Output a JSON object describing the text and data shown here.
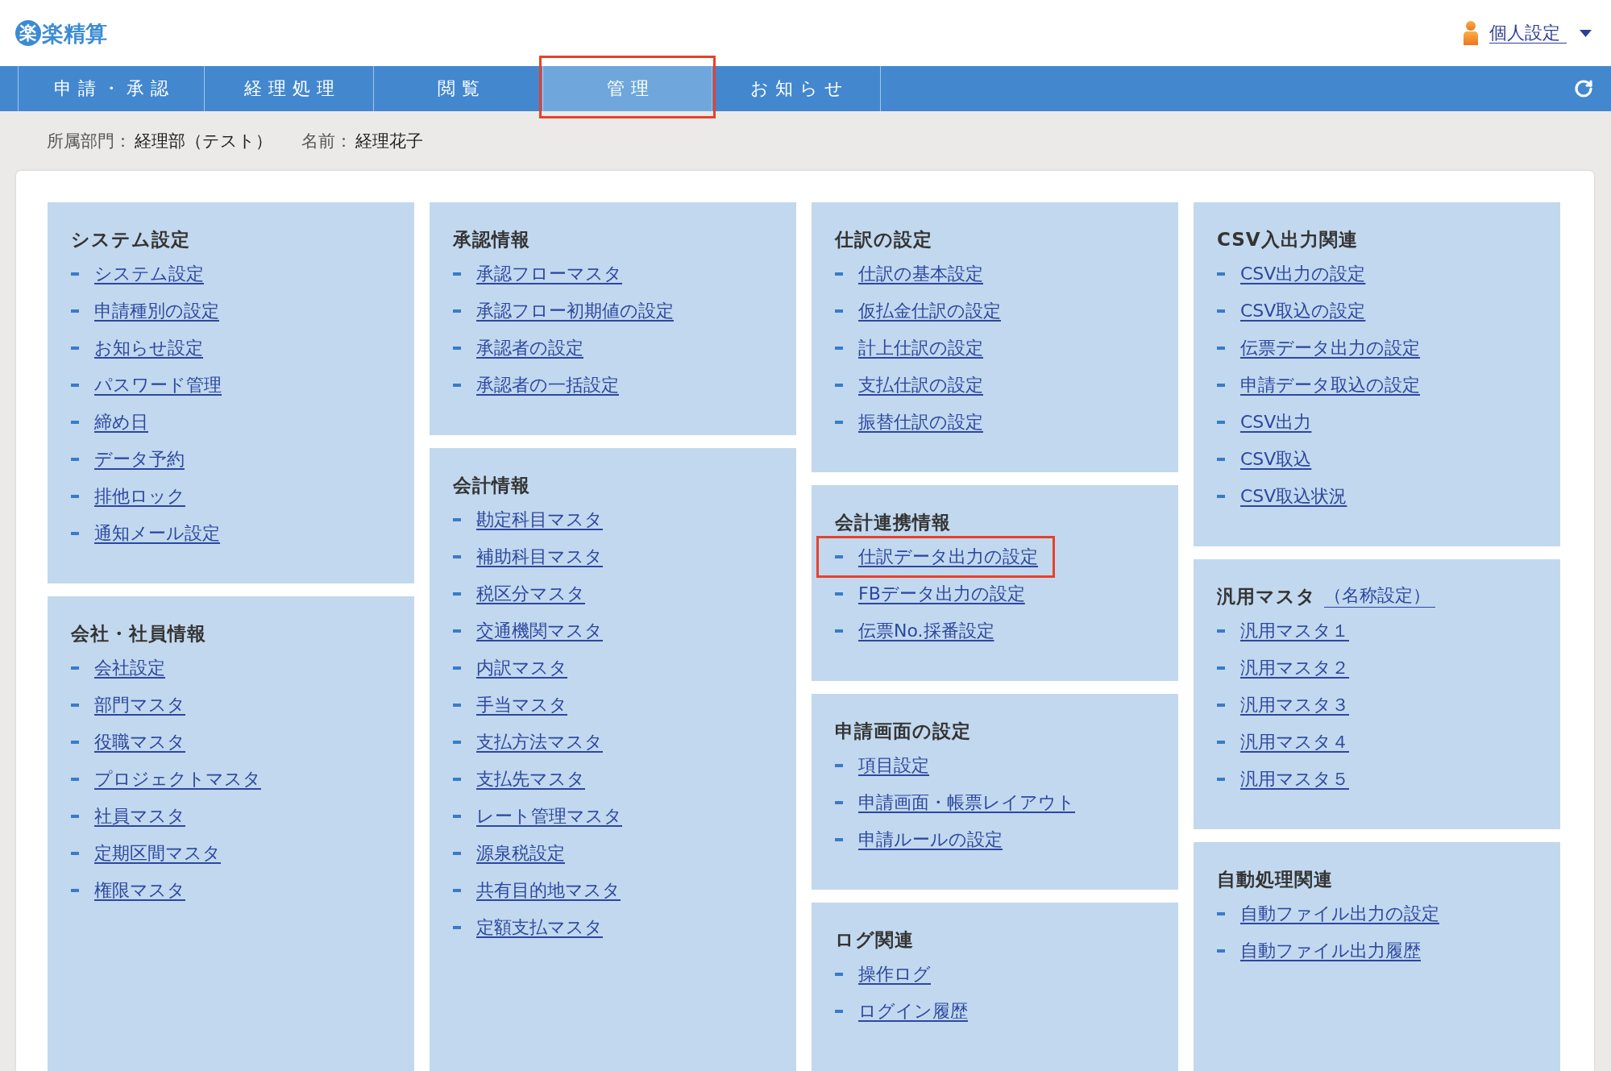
{
  "logo": {
    "mark": "楽",
    "text": "楽精算"
  },
  "user_menu": {
    "label": "個人設定"
  },
  "tabs": [
    {
      "label": "申請・承認",
      "selected": false,
      "highlighted": false
    },
    {
      "label": "経理処理",
      "selected": false,
      "highlighted": false
    },
    {
      "label": "閲覧",
      "selected": false,
      "highlighted": false
    },
    {
      "label": "管理",
      "selected": true,
      "highlighted": true
    },
    {
      "label": "お知らせ",
      "selected": false,
      "highlighted": false
    }
  ],
  "user_info": [
    {
      "label": "所属部門：",
      "value": "経理部（テスト）"
    },
    {
      "label": "名前：",
      "value": "経理花子"
    }
  ],
  "columns": [
    {
      "panels": [
        {
          "title": "システム設定",
          "links": [
            {
              "label": "システム設定",
              "highlighted": false
            },
            {
              "label": "申請種別の設定",
              "highlighted": false
            },
            {
              "label": "お知らせ設定",
              "highlighted": false
            },
            {
              "label": "パスワード管理",
              "highlighted": false
            },
            {
              "label": "締め日",
              "highlighted": false
            },
            {
              "label": "データ予約",
              "highlighted": false
            },
            {
              "label": "排他ロック",
              "highlighted": false
            },
            {
              "label": "通知メール設定",
              "highlighted": false
            }
          ]
        },
        {
          "title": "会社・社員情報",
          "links": [
            {
              "label": "会社設定",
              "highlighted": false
            },
            {
              "label": "部門マスタ",
              "highlighted": false
            },
            {
              "label": "役職マスタ",
              "highlighted": false
            },
            {
              "label": "プロジェクトマスタ",
              "highlighted": false
            },
            {
              "label": "社員マスタ",
              "highlighted": false
            },
            {
              "label": "定期区間マスタ",
              "highlighted": false
            },
            {
              "label": "権限マスタ",
              "highlighted": false
            }
          ]
        }
      ]
    },
    {
      "panels": [
        {
          "title": "承認情報",
          "links": [
            {
              "label": "承認フローマスタ",
              "highlighted": false
            },
            {
              "label": "承認フロー初期値の設定",
              "highlighted": false
            },
            {
              "label": "承認者の設定",
              "highlighted": false
            },
            {
              "label": "承認者の一括設定",
              "highlighted": false
            }
          ]
        },
        {
          "title": "会計情報",
          "links": [
            {
              "label": "勘定科目マスタ",
              "highlighted": false
            },
            {
              "label": "補助科目マスタ",
              "highlighted": false
            },
            {
              "label": "税区分マスタ",
              "highlighted": false
            },
            {
              "label": "交通機関マスタ",
              "highlighted": false
            },
            {
              "label": "内訳マスタ",
              "highlighted": false
            },
            {
              "label": "手当マスタ",
              "highlighted": false
            },
            {
              "label": "支払方法マスタ",
              "highlighted": false
            },
            {
              "label": "支払先マスタ",
              "highlighted": false
            },
            {
              "label": "レート管理マスタ",
              "highlighted": false
            },
            {
              "label": "源泉税設定",
              "highlighted": false
            },
            {
              "label": "共有目的地マスタ",
              "highlighted": false
            },
            {
              "label": "定額支払マスタ",
              "highlighted": false
            }
          ]
        }
      ]
    },
    {
      "panels": [
        {
          "title": "仕訳の設定",
          "links": [
            {
              "label": "仕訳の基本設定",
              "highlighted": false
            },
            {
              "label": "仮払金仕訳の設定",
              "highlighted": false
            },
            {
              "label": "計上仕訳の設定",
              "highlighted": false
            },
            {
              "label": "支払仕訳の設定",
              "highlighted": false
            },
            {
              "label": "振替仕訳の設定",
              "highlighted": false
            }
          ]
        },
        {
          "title": "会計連携情報",
          "links": [
            {
              "label": "仕訳データ出力の設定",
              "highlighted": true
            },
            {
              "label": "FBデータ出力の設定",
              "highlighted": false
            },
            {
              "label": "伝票No.採番設定",
              "highlighted": false
            }
          ]
        },
        {
          "title": "申請画面の設定",
          "links": [
            {
              "label": "項目設定",
              "highlighted": false
            },
            {
              "label": "申請画面・帳票レイアウト",
              "highlighted": false
            },
            {
              "label": "申請ルールの設定",
              "highlighted": false
            }
          ]
        },
        {
          "title": "ログ関連",
          "links": [
            {
              "label": "操作ログ",
              "highlighted": false
            },
            {
              "label": "ログイン履歴",
              "highlighted": false
            }
          ]
        }
      ]
    },
    {
      "panels": [
        {
          "title": "CSV入出力関連",
          "links": [
            {
              "label": "CSV出力の設定",
              "highlighted": false
            },
            {
              "label": "CSV取込の設定",
              "highlighted": false
            },
            {
              "label": "伝票データ出力の設定",
              "highlighted": false
            },
            {
              "label": "申請データ取込の設定",
              "highlighted": false
            },
            {
              "label": "CSV出力",
              "highlighted": false
            },
            {
              "label": "CSV取込",
              "highlighted": false
            },
            {
              "label": "CSV取込状況",
              "highlighted": false
            }
          ]
        },
        {
          "title": "汎用マスタ",
          "title_link": "（名称設定）",
          "links": [
            {
              "label": "汎用マスタ１",
              "highlighted": false
            },
            {
              "label": "汎用マスタ２",
              "highlighted": false
            },
            {
              "label": "汎用マスタ３",
              "highlighted": false
            },
            {
              "label": "汎用マスタ４",
              "highlighted": false
            },
            {
              "label": "汎用マスタ５",
              "highlighted": false
            }
          ]
        },
        {
          "title": "自動処理関連",
          "links": [
            {
              "label": "自動ファイル出力の設定",
              "highlighted": false
            },
            {
              "label": "自動ファイル出力履歴",
              "highlighted": false
            }
          ]
        }
      ]
    }
  ]
}
